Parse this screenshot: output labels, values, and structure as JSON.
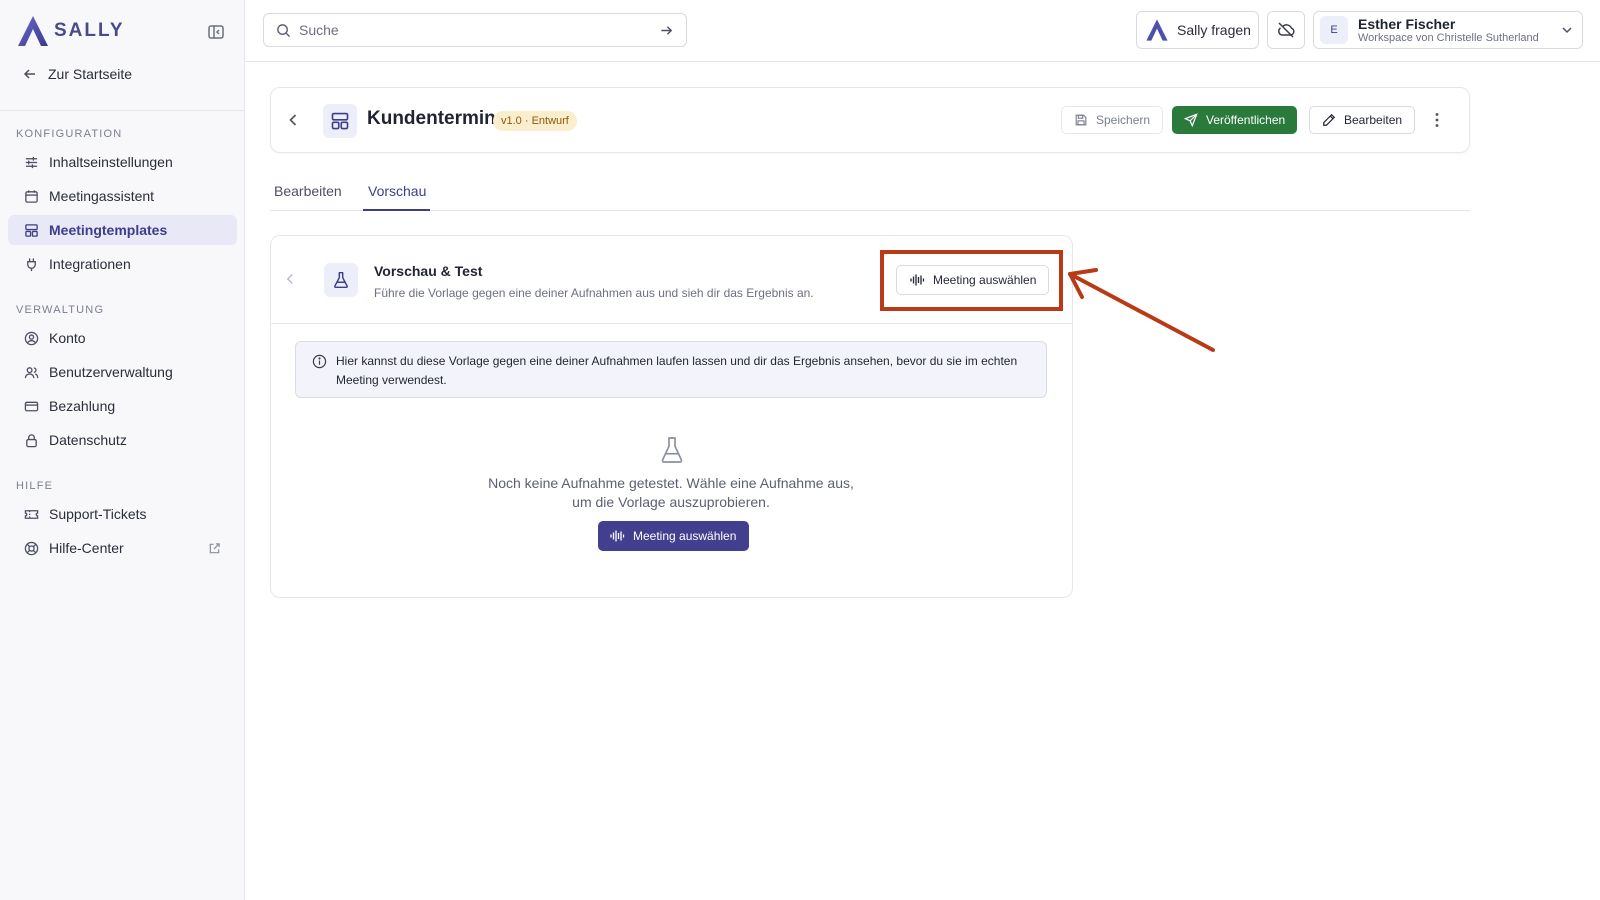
{
  "colors": {
    "brand": "#3d3d8a",
    "publish": "#2a7a3c",
    "annotation": "#b83a17",
    "badge_bg": "#fbeecd"
  },
  "brand": {
    "name": "SALLY"
  },
  "sidebar": {
    "back_label": "Zur Startseite",
    "sections": [
      {
        "title": "KONFIGURATION",
        "items": [
          {
            "label": "Inhaltseinstellungen",
            "icon": "sliders-icon"
          },
          {
            "label": "Meetingassistent",
            "icon": "calendar-icon"
          },
          {
            "label": "Meetingtemplates",
            "icon": "layout-template-icon",
            "active": true
          },
          {
            "label": "Integrationen",
            "icon": "plug-icon"
          }
        ]
      },
      {
        "title": "VERWALTUNG",
        "items": [
          {
            "label": "Konto",
            "icon": "user-circle-icon"
          },
          {
            "label": "Benutzerverwaltung",
            "icon": "users-icon"
          },
          {
            "label": "Bezahlung",
            "icon": "credit-card-icon"
          },
          {
            "label": "Datenschutz",
            "icon": "lock-icon"
          }
        ]
      },
      {
        "title": "HILFE",
        "items": [
          {
            "label": "Support-Tickets",
            "icon": "ticket-icon"
          },
          {
            "label": "Hilfe-Center",
            "icon": "lifebuoy-icon",
            "external": true
          }
        ]
      }
    ]
  },
  "topbar": {
    "search_placeholder": "Suche",
    "ask_label": "Sally fragen",
    "user": {
      "initial": "E",
      "name": "Esther Fischer",
      "workspace": "Workspace von Christelle Sutherland"
    }
  },
  "header": {
    "title": "Kundentermin",
    "badge": "v1.0 · Entwurf",
    "save_label": "Speichern",
    "publish_label": "Veröffentlichen",
    "edit_label": "Bearbeiten"
  },
  "tabs": [
    {
      "label": "Bearbeiten",
      "active": false
    },
    {
      "label": "Vorschau",
      "active": true
    }
  ],
  "preview": {
    "title": "Vorschau & Test",
    "description": "Führe die Vorlage gegen eine deiner Aufnahmen aus und sieh dir das Ergebnis an.",
    "select_label": "Meeting auswählen",
    "info_text": "Hier kannst du diese Vorlage gegen eine deiner Aufnahmen laufen lassen und dir das Ergebnis ansehen, bevor du sie im echten Meeting verwendest.",
    "empty_line1": "Noch keine Aufnahme getestet. Wähle eine Aufnahme aus,",
    "empty_line2": "um die Vorlage auszuprobieren.",
    "empty_button": "Meeting auswählen"
  }
}
